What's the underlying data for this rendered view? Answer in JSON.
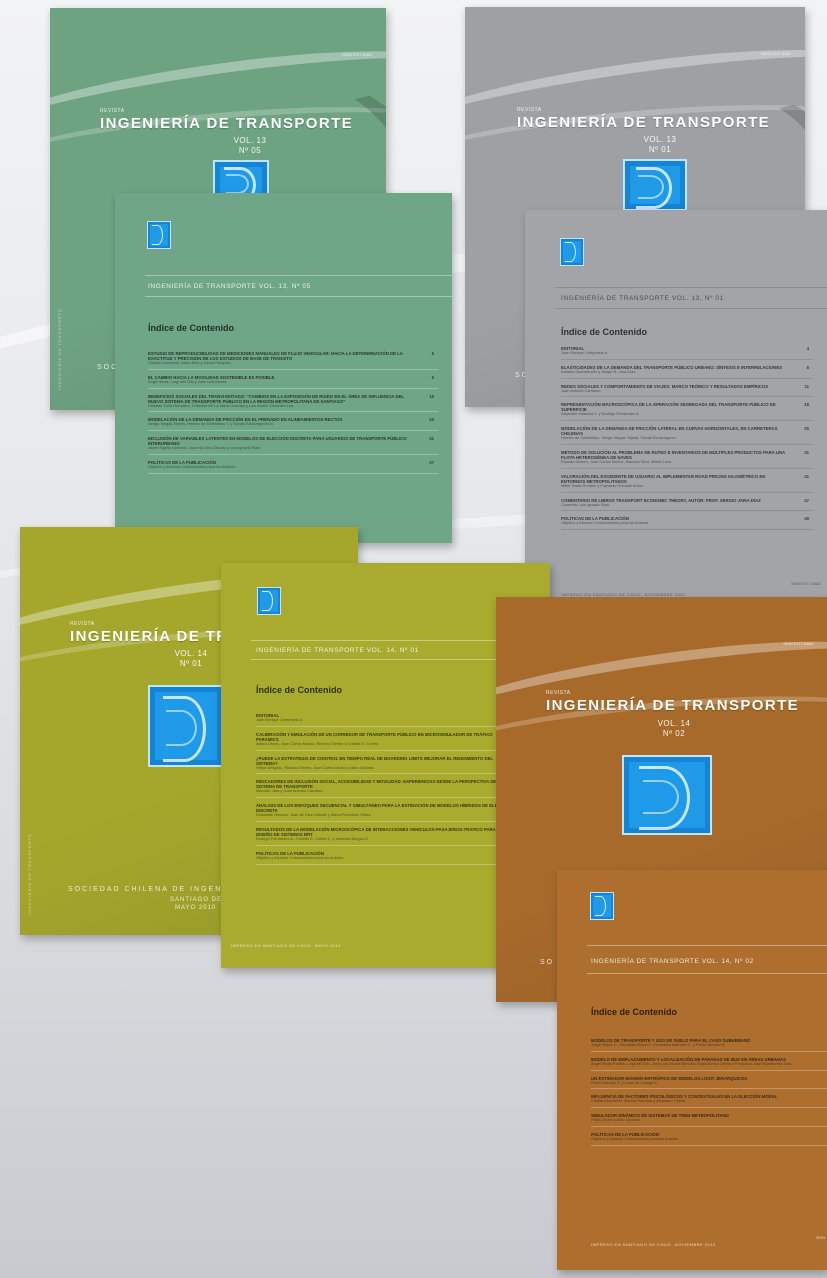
{
  "covers": [
    {
      "revista": "REVISTA",
      "title": "INGENIERÍA DE TRANSPORTE",
      "vol": "VOL. 13",
      "num": "Nº 05",
      "issn": "ISSN 0717-5482",
      "society": "SOC",
      "spine": "INGENIERÍA DE TRANSPORTE",
      "color": "#6ea382"
    },
    {
      "revista": "REVISTA",
      "title": "INGENIERÍA DE TRANSPORTE",
      "vol": "VOL. 13",
      "num": "Nº 01",
      "issn": "ISSN 0717-5482",
      "society": "SO",
      "spine": "INGENIERÍA DE TRANSPORTE",
      "color": "#9ea0a3"
    },
    {
      "revista": "REVISTA",
      "title": "INGENIERÍA DE TR",
      "vol": "VOL. 14",
      "num": "Nº 01",
      "issn": "",
      "society": "SOCIEDAD CHILENA DE INGENIE",
      "place": "SANTIAGO DE CHI",
      "date": "MAYO 2010",
      "spine": "INGENIERÍA DE TRANSPORTE",
      "color": "#a5a72c"
    },
    {
      "revista": "REVISTA",
      "title": "INGENIERÍA DE TRANSPORTE",
      "vol": "VOL. 14",
      "num": "Nº 02",
      "issn": "ISSN 0717-5482",
      "society": "SO",
      "spine": "INGENIERÍA DE TRANSPORTE",
      "color": "#a86a2b"
    }
  ],
  "pages": [
    {
      "running": "INGENIERÍA DE TRANSPORTE VOL. 13, Nº 05",
      "toc_title": "Índice de Contenido",
      "color": "#6fa687",
      "entries": [
        {
          "t": "ESTUDIO DE REPRODUCIBILIDAD DE MEDICIONES MANUALES DE FLUJO VEHICULAR: HACIA LA DETERMINACIÓN DE LA EXACTITUD Y PRECISIÓN DE LOS ESTUDIOS DE BASE DE TRÁNSITO",
          "a": "Cristian Domarchi, Ivana Brito y Oscar Hinojosa",
          "p": "5"
        },
        {
          "t": "EL CAMBIO HACIA LA MOVILIDAD SOSTENIBLE ES POSIBLE",
          "a": "Ángel Ibeas, Luigi dell'Olio y José Luis Moura",
          "p": "9"
        },
        {
          "t": "BENEFICIOS SOCIALES DEL TRANVIANTIAGO: \"CAMBIOS EN LA EXPOSICIÓN DE RUIDO EN EL ÁREA DE INFLUENCIA DEL NUEVO SISTEMA DE TRANSPORTE PÚBLICO EN LA REGIÓN METROPOLITANA DE SANTIAGO\"",
          "a": "Esteban Tuñá González, Cristóbal De La Maza Guzmán y Luis Abdón Cifuentes Lira",
          "p": "15"
        },
        {
          "t": "MODELACIÓN DE LA DEMANDA DE FRICCIÓN EN EL FRENADO EN ALINEAMIENTOS RECTOS",
          "a": "Sergio Vargas Tejeda, Hernán de Solminihac T. y Tomás Echaveguren N.",
          "p": "23"
        },
        {
          "t": "INCLUSIÓN DE VARIABLES LATENTES EN MODELOS DE ELECCIÓN DISCRETA PARA USUARIOS DE TRANSPORTE PÚBLICO INTERURBANO",
          "a": "Javier Egaña Lipinovic, Juan de Dios Ortúzar y Luis Ignacio Rizzi",
          "p": "31"
        },
        {
          "t": "POLÍTICAS DE LA PUBLICACIÓN",
          "a": "Objetivo y Alcance / Instrucciones para los Autores",
          "p": "37"
        }
      ]
    },
    {
      "running": "INGENIERÍA DE TRANSPORTE VOL. 13, Nº 01",
      "toc_title": "Índice de Contenido",
      "color": "#a2a4a7",
      "issn": "ISSN 0717-5482",
      "imprint": "IMPRESO EN SANTIAGO DE CHILE, NOVIEMBRE 2007",
      "entries": [
        {
          "t": "EDITORIAL",
          "a": "Juan Enrique Coeymans A.",
          "p": "4"
        },
        {
          "t": "ELASTICIDADES DE LA DEMANDA DEL TRANSPORTE PÚBLICO URBANO: SÍNTESIS E INTERRELACIONES",
          "a": "Antonio Gschwender y Sergio R. Jara-Díaz",
          "p": "5"
        },
        {
          "t": "REDES SOCIALES Y COMPORTAMIENTO DE VIAJES: MARCO TEÓRICO Y RESULTADOS EMPÍRICOS",
          "a": "Juan Antonio Carrasco",
          "p": "11"
        },
        {
          "t": "REPRESENTACIÓN MACROSCÓPICA DE LA OPERACIÓN SEGREGADA DEL TRANSPORTE PÚBLICO DE SUPERFICIE",
          "a": "Alejandro Valencia V. y Rodrigo Fernández A.",
          "p": "18"
        },
        {
          "t": "MODELACIÓN DE LA DEMANDA DE FRICCIÓN LATERAL EN CURVAS HORIZONTALES, EN CARRETERAS CHILENAS",
          "a": "Hernán de Solminihac, Sergio Vargas Tejeda, Tomás Echaveguren",
          "p": "26"
        },
        {
          "t": "MÉTODO DE SOLUCIÓN AL PROBLEMA DE RUTEO E INVENTARIOS DE MÚLTIPLES PRODUCTOS PARA UNA FLOTA HETEROGÉNEA DE NAVES",
          "a": "Ricardo Giesen, Juan Carlos Muñoz, Marcela Silva, Mabel Leva",
          "p": "31"
        },
        {
          "t": "VALORACIÓN DEL EXCEDENTE DE USUARIO AL IMPLEMENTAR ROAD PRICING KILOMÉTRICO EN ENTORNOS METROPOLITANOS",
          "a": "Mitter Salas Rondón y Francesc Robusté Antón",
          "p": "41"
        },
        {
          "t": "COMENTARIO DE LIBROS TRANSPORT ECONOMIC THEORY, AUTOR: PROF. SERGIO JARA-DÍAZ",
          "a": "Comenta: Luis Ignacio Rizzi",
          "p": "47"
        },
        {
          "t": "POLÍTICAS DE LA PUBLICACIÓN",
          "a": "Objetivo y Alcance / Instrucciones para los Autores",
          "p": "49"
        }
      ]
    },
    {
      "running": "INGENIERÍA DE TRANSPORTE VOL. 14, Nº 01",
      "toc_title": "Índice de Contenido",
      "color": "#a8ab2e",
      "imprint": "IMPRESO EN SANTIAGO DE CHILE, MAYO 2010",
      "edge": "ISSN",
      "entries": [
        {
          "t": "EDITORIAL",
          "a": "Juan Enrique Coeymans A.",
          "p": ""
        },
        {
          "t": "CALIBRACIÓN Y EMULACIÓN DE UN CORREDOR DE TRANSPORTE PÚBLICO EN MICROSIMULADOR DE TRÁFICO PARAMICS",
          "a": "Arturo Osses, Juan Carlos Muñoz, Ricardo Giesen y Cristián E. Cortés",
          "p": ""
        },
        {
          "t": "¿PUEDE LA ESTRATEGIA DE CONTROL EN TIEMPO REAL DE BOARDING LIMITS MEJORAR EL RENDIMIENTO DEL SISTEMA?",
          "a": "Felipe Delgado, Ricardo Giesen, Juan Carlos Muñoz y Aldo Cipriano",
          "p": ""
        },
        {
          "t": "INDICADORES DE INCLUSIÓN SOCIAL, ACCESIBILIDAD Y MOVILIDAD: EXPERIENCIAS DESDE LA PERSPECTIVA DEL SISTEMA DE TRANSPORTE",
          "a": "Mauricio Jara y Juan Antonio Carrasco",
          "p": ""
        },
        {
          "t": "ANÁLISIS DE LOS ENFOQUES SECUENCIAL Y SIMULTÁNEO PARA LA ESTIMACIÓN DE MODELOS HÍBRIDOS DE ELECCIÓN DISCRETA",
          "a": "Sebastián Raveau, Juan de Dios Ortúzar y María Francisca Yáñez",
          "p": ""
        },
        {
          "t": "RESULTADOS DE LA MODELACIÓN MICROSCÓPICA DE INTERACCIONES VEHÍCULOS-PASAJEROS-TRÁFICO PARA EL DISEÑO DE SISTEMAS BRT",
          "a": "Rodrigo Fernández A., Cristián E. Cortés C. y Vanessa Burgos O.",
          "p": ""
        },
        {
          "t": "POLÍTICAS DE LA PUBLICACIÓN",
          "a": "Objetivo y Alcance / Instrucciones para los Autores",
          "p": ""
        }
      ]
    },
    {
      "running": "INGENIERÍA DE TRANSPORTE VOL. 14, Nº 02",
      "toc_title": "Índice de Contenido",
      "color": "#ad6e2e",
      "imprint": "IMPRESO EN SANTIAGO DE CHILE, NOVIEMBRE 2010",
      "edge": "ISSN",
      "entries": [
        {
          "t": "MODELOS DE TRANSPORTE Y USO DE SUELO PARA EL CASO SUBURBANO",
          "a": "Jorge Videla C., Fernando Bravo F., Francisca Martínez C. y Pedro Donoso S.",
          "p": ""
        },
        {
          "t": "MODELO DE EMPLAZAMIENTO Y LOCALIZACIÓN DE PARADAS DE BUS EN ÁREAS URBANAS",
          "a": "Ángel Ibeas Portilla, Luigi dell'Olio, José Luis Moura Berodia, Borja Alonso Oreña y Francisco José Ruisánchez Díaz",
          "p": ""
        },
        {
          "t": "UN ESTIMADOR MÁXIMO-ENTRÓPICO DE MODELOS LOGIT JERÁRQUICOS",
          "a": "Pedro Donoso S. y Louis de Grange C.",
          "p": ""
        },
        {
          "t": "INFLUENCIA DE FACTORES PSICOLÓGICOS Y CONTEXTUALES EN LA ELECCIÓN MODAL",
          "a": "Cristián Domarchi, Manuel Escobar y Alejandro Tudela",
          "p": ""
        },
        {
          "t": "SIMULADOR DINÁMICO DE SISTEMAS DE TREN METROPOLITANO",
          "a": "Pablo Grube y Aldo Cipriano",
          "p": ""
        },
        {
          "t": "POLÍTICAS DE LA PUBLICACIÓN",
          "a": "Objetivo y Alcance / Instrucciones para los Autores",
          "p": ""
        }
      ]
    }
  ]
}
